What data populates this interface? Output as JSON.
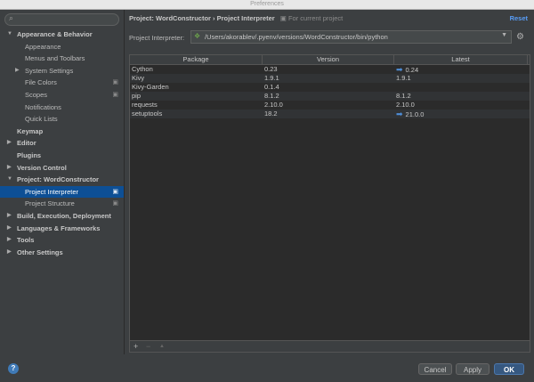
{
  "window": {
    "title": "Preferences"
  },
  "search": {
    "placeholder": ""
  },
  "tree": [
    {
      "label": "Appearance & Behavior",
      "level": 0,
      "bold": true,
      "arrow": "▼"
    },
    {
      "label": "Appearance",
      "level": 1
    },
    {
      "label": "Menus and Toolbars",
      "level": 1
    },
    {
      "label": "System Settings",
      "level": 1,
      "arrow": "▶"
    },
    {
      "label": "File Colors",
      "level": 1,
      "proj": true
    },
    {
      "label": "Scopes",
      "level": 1,
      "proj": true
    },
    {
      "label": "Notifications",
      "level": 1
    },
    {
      "label": "Quick Lists",
      "level": 1
    },
    {
      "label": "Keymap",
      "level": 0,
      "bold": true
    },
    {
      "label": "Editor",
      "level": 0,
      "bold": true,
      "arrow": "▶"
    },
    {
      "label": "Plugins",
      "level": 0,
      "bold": true
    },
    {
      "label": "Version Control",
      "level": 0,
      "bold": true,
      "arrow": "▶"
    },
    {
      "label": "Project: WordConstructor",
      "level": 0,
      "bold": true,
      "arrow": "▼"
    },
    {
      "label": "Project Interpreter",
      "level": 1,
      "selected": true,
      "proj": true
    },
    {
      "label": "Project Structure",
      "level": 1,
      "proj": true
    },
    {
      "label": "Build, Execution, Deployment",
      "level": 0,
      "bold": true,
      "arrow": "▶"
    },
    {
      "label": "Languages & Frameworks",
      "level": 0,
      "bold": true,
      "arrow": "▶"
    },
    {
      "label": "Tools",
      "level": 0,
      "bold": true,
      "arrow": "▶"
    },
    {
      "label": "Other Settings",
      "level": 0,
      "bold": true,
      "arrow": "▶"
    }
  ],
  "breadcrumb": {
    "project": "Project: WordConstructor",
    "separator": "›",
    "page": "Project Interpreter",
    "note": "For current project"
  },
  "reset_label": "Reset",
  "interpreter": {
    "label": "Project Interpreter:",
    "value": "/Users/akorablev/.pyenv/versions/WordConstructor/bin/python"
  },
  "packages": {
    "columns": [
      "Package",
      "Version",
      "Latest"
    ],
    "rows": [
      {
        "package": "Cython",
        "version": "0.23",
        "latest": "0.24",
        "upgrade": true
      },
      {
        "package": "Kivy",
        "version": "1.9.1",
        "latest": "1.9.1",
        "upgrade": false
      },
      {
        "package": "Kivy-Garden",
        "version": "0.1.4",
        "latest": "",
        "upgrade": false
      },
      {
        "package": "pip",
        "version": "8.1.2",
        "latest": "8.1.2",
        "upgrade": false
      },
      {
        "package": "requests",
        "version": "2.10.0",
        "latest": "2.10.0",
        "upgrade": false
      },
      {
        "package": "setuptools",
        "version": "18.2",
        "latest": "21.0.0",
        "upgrade": true
      }
    ]
  },
  "toolbar": {
    "add": "+",
    "remove": "−",
    "upgrade": "▲"
  },
  "buttons": {
    "cancel": "Cancel",
    "apply": "Apply",
    "ok": "OK",
    "help": "?"
  },
  "colors": {
    "accent": "#589df6",
    "selection": "#0d4f95",
    "ok_button": "#365880"
  }
}
